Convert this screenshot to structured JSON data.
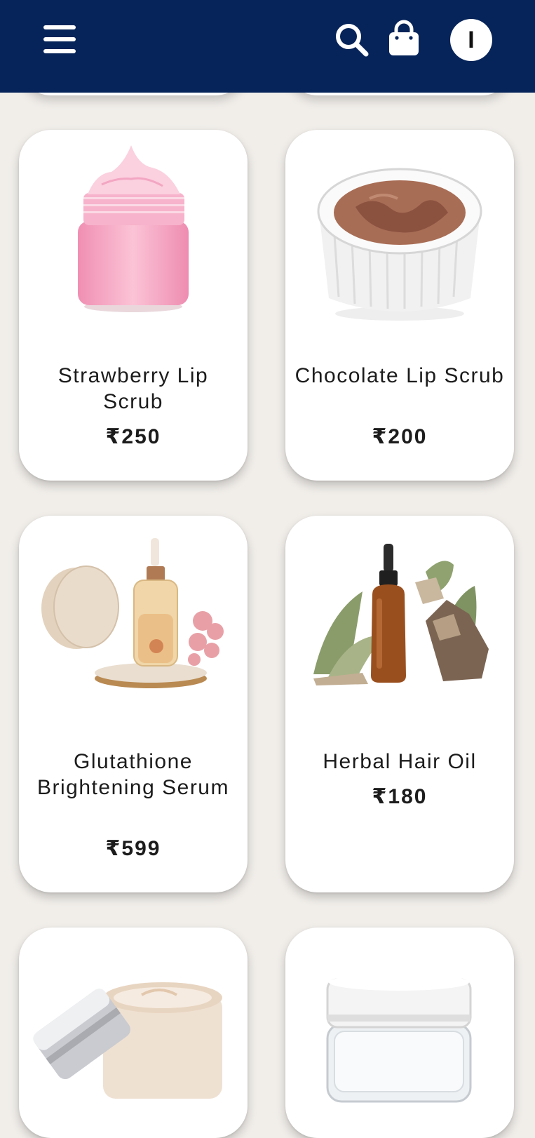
{
  "header": {
    "menu_icon": "hamburger-menu-icon",
    "search_icon": "search-icon",
    "cart_icon": "shopping-bag-icon",
    "profile_initial": "I",
    "bg_color": "#062459"
  },
  "products": [
    {
      "name": "Strawberry Lip Scrub",
      "price": "₹250",
      "image": "pink-cream-jar"
    },
    {
      "name": "Chocolate Lip Scrub",
      "price": "₹200",
      "image": "chocolate-scrub-bowl"
    },
    {
      "name": "Glutathione Brightening Serum",
      "price": "₹599",
      "image": "serum-dropper-bottle"
    },
    {
      "name": "Herbal Hair Oil",
      "price": "₹180",
      "image": "amber-oil-bottle"
    },
    {
      "name": "",
      "price": "",
      "image": "cream-jar-silver-lid"
    },
    {
      "name": "",
      "price": "",
      "image": "clear-glass-jar"
    }
  ]
}
